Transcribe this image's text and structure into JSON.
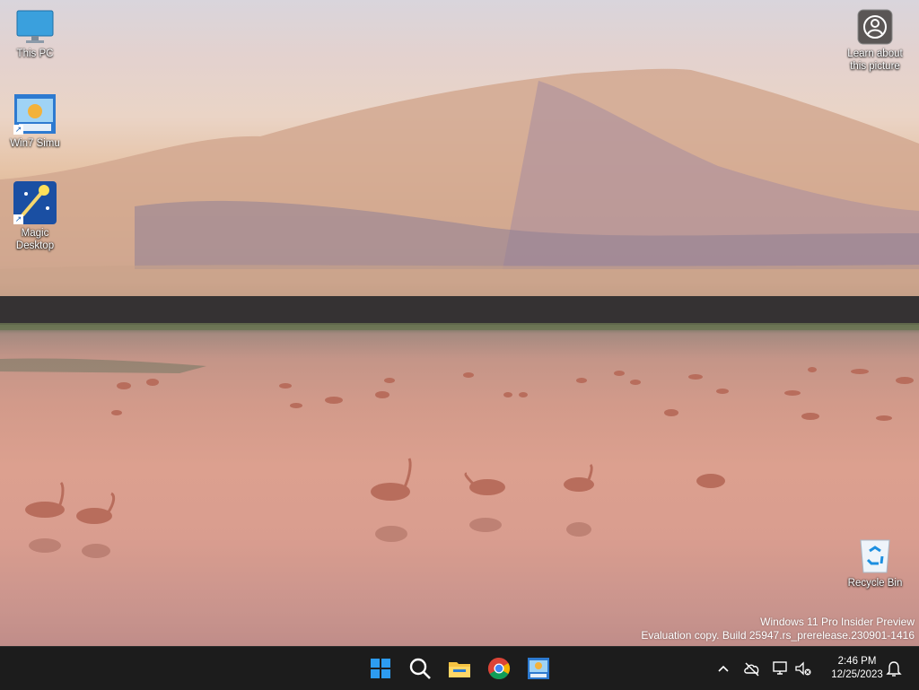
{
  "desktop": {
    "icons": [
      {
        "label": "This PC",
        "icon": "monitor-icon"
      },
      {
        "label": "Win7 Simu",
        "icon": "win7-simu-icon"
      },
      {
        "label": "Magic\nDesktop",
        "icon": "magic-desktop-icon"
      },
      {
        "label": "Recycle Bin",
        "icon": "recycle-bin-icon"
      }
    ],
    "learn_about_picture": "Learn about\nthis picture"
  },
  "watermark": {
    "line1": "Windows 11 Pro Insider Preview",
    "line2": "Evaluation copy. Build 25947.rs_prerelease.230901-1416"
  },
  "taskbar": {
    "apps": [
      "start-icon",
      "search-icon",
      "file-explorer-icon",
      "chrome-icon",
      "win7-simu-icon"
    ],
    "tray": [
      "chevron-up-icon",
      "cloud-offline-icon",
      "network-icon",
      "volume-muted-icon"
    ],
    "time": "2:46 PM",
    "date": "12/25/2023"
  },
  "colors": {
    "taskbar_bg": "#1c1c1c",
    "accent_blue": "#0078d4"
  }
}
